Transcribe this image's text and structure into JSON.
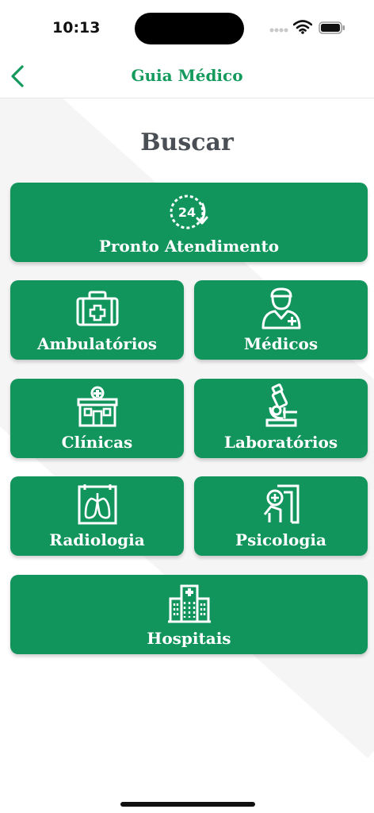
{
  "status_bar": {
    "time": "10:13"
  },
  "nav": {
    "title": "Guia Médico"
  },
  "page": {
    "heading": "Buscar"
  },
  "tiles": [
    {
      "label": "Pronto Atendimento",
      "icon": "clock-24-icon"
    },
    {
      "label": "Ambulatórios",
      "icon": "first-aid-kit-icon"
    },
    {
      "label": "Médicos",
      "icon": "doctor-icon"
    },
    {
      "label": "Clínicas",
      "icon": "clinic-building-icon"
    },
    {
      "label": "Laboratórios",
      "icon": "microscope-icon"
    },
    {
      "label": "Radiologia",
      "icon": "x-ray-lungs-icon"
    },
    {
      "label": "Psicologia",
      "icon": "psychology-icon"
    },
    {
      "label": "Hospitais",
      "icon": "hospital-building-icon"
    }
  ],
  "colors": {
    "brand": "#12955c",
    "title": "#149a5c",
    "heading": "#4a4f55"
  }
}
